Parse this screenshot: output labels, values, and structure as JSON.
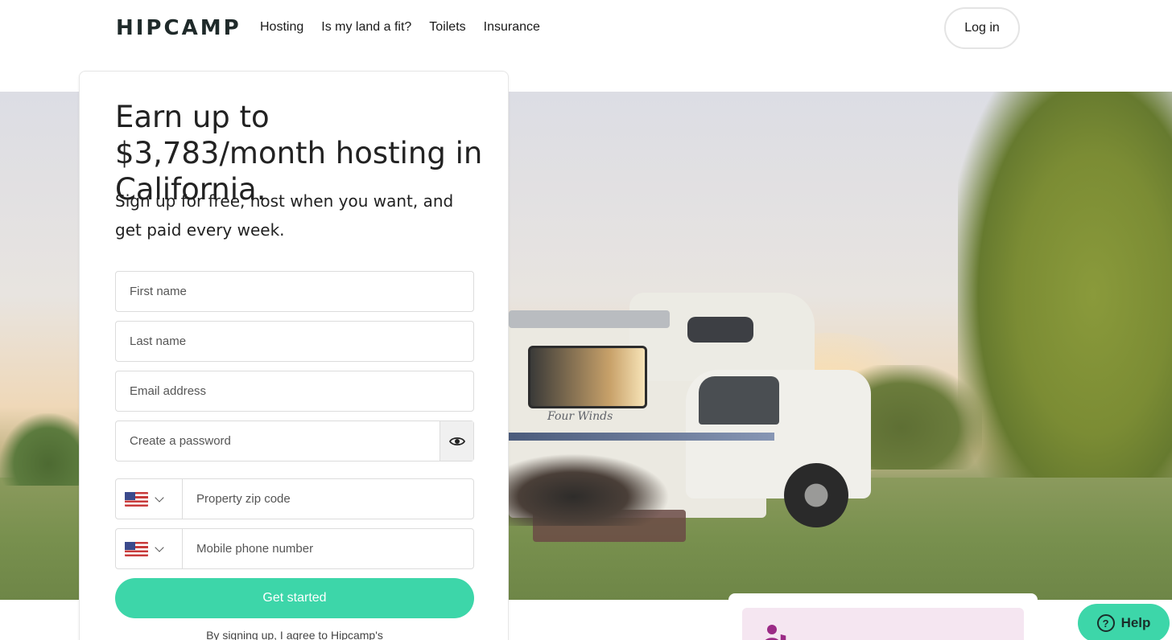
{
  "header": {
    "logo": "HIPCAMP",
    "nav": [
      "Hosting",
      "Is my land a fit?",
      "Toilets",
      "Insurance"
    ],
    "login_label": "Log in"
  },
  "signup": {
    "headline": "Earn up to $3,783/month hosting in California.",
    "subhead": "Sign up for free, host when you want, and get paid every week.",
    "first_name_placeholder": "First name",
    "last_name_placeholder": "Last name",
    "email_placeholder": "Email address",
    "password_placeholder": "Create a password",
    "zip_placeholder": "Property zip code",
    "phone_placeholder": "Mobile phone number",
    "cta_label": "Get started",
    "terms": "By signing up, I agree to Hipcamp's"
  },
  "hero": {
    "rv_brand": "Four Winds"
  },
  "help": {
    "label": "Help",
    "icon": "question-icon"
  },
  "colors": {
    "accent": "#3dd6a9",
    "text": "#1a1a1a",
    "info_bg": "#f5e6f1",
    "info_icon": "#9b2a86"
  },
  "icons": [
    "eye-icon",
    "us-flag-icon",
    "chevron-down-icon",
    "question-icon",
    "user-shield-icon"
  ]
}
